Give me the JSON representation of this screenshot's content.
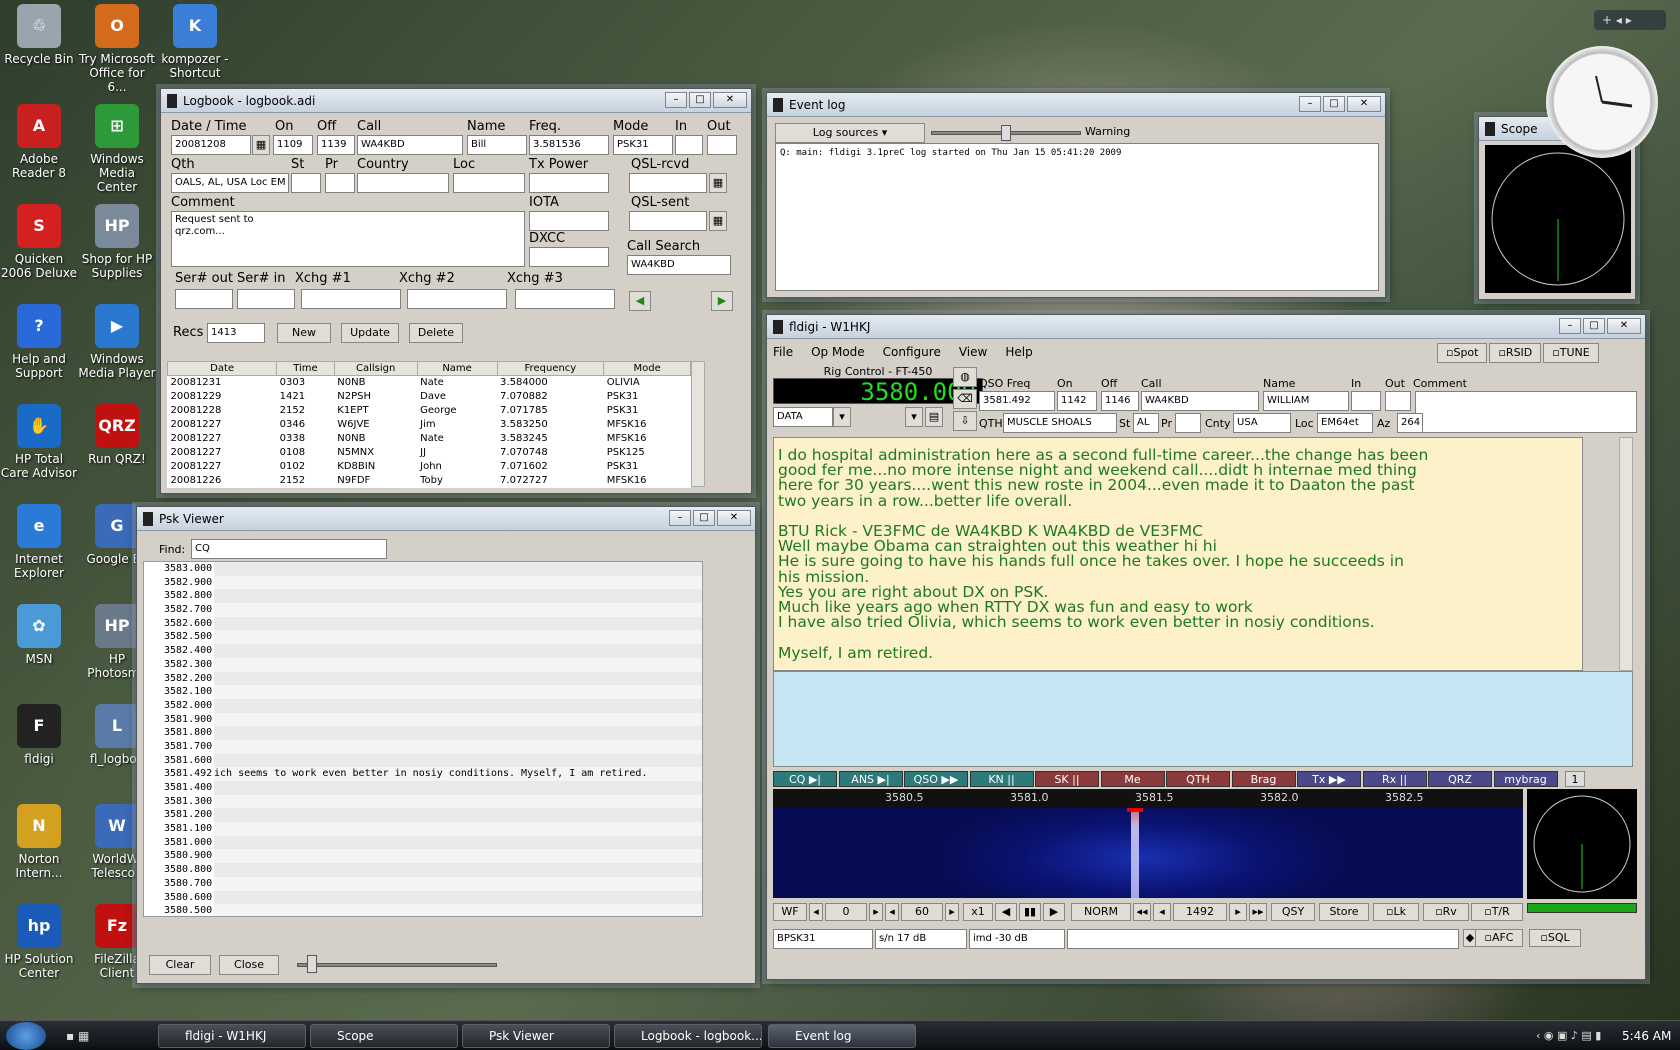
{
  "desktop": {
    "icons": [
      {
        "label": "Recycle Bin",
        "color": "#9aa4ac",
        "glyph": "♲"
      },
      {
        "label": "Try Microsoft Office for 6...",
        "color": "#d46a1c",
        "glyph": "O"
      },
      {
        "label": "kompozer - Shortcut",
        "color": "#3a7ed8",
        "glyph": "K"
      },
      {
        "label": "Adobe Reader 8",
        "color": "#c8201e",
        "glyph": "A"
      },
      {
        "label": "Windows Media Center",
        "color": "#2d9a3a",
        "glyph": "⊞"
      },
      {
        "label": "Quicken 2006 Deluxe",
        "color": "#d42020",
        "glyph": "S"
      },
      {
        "label": "Shop for HP Supplies",
        "color": "#7a8a9a",
        "glyph": "HP"
      },
      {
        "label": "Help and Support",
        "color": "#2a6ad8",
        "glyph": "?"
      },
      {
        "label": "Windows Media Player",
        "color": "#2a78d0",
        "glyph": "▶"
      },
      {
        "label": "HP Total Care Advisor",
        "color": "#1a6ac8",
        "glyph": "✋"
      },
      {
        "label": "Run QRZ!",
        "color": "#c01010",
        "glyph": "QRZ"
      },
      {
        "label": "Internet Explorer",
        "color": "#2a7ad8",
        "glyph": "e"
      },
      {
        "label": "Google Ea",
        "color": "#3a6ab8",
        "glyph": "G"
      },
      {
        "label": "MSN",
        "color": "#4a9ad8",
        "glyph": "✿"
      },
      {
        "label": "HP Photosma",
        "color": "#6a7a8a",
        "glyph": "HP"
      },
      {
        "label": "fldigi",
        "color": "#222",
        "glyph": "F"
      },
      {
        "label": "fl_logboo",
        "color": "#5a7aa8",
        "glyph": "L"
      },
      {
        "label": "Norton Intern...",
        "color": "#d4a020",
        "glyph": "N"
      },
      {
        "label": "WorldWi Telescop",
        "color": "#3a6ab8",
        "glyph": "W"
      },
      {
        "label": "HP Solution Center",
        "color": "#1a5ab8",
        "glyph": "hp"
      },
      {
        "label": "FileZilla Client",
        "color": "#c01010",
        "glyph": "Fz"
      }
    ]
  },
  "logbook": {
    "title": "Logbook - logbook.adi",
    "labels": {
      "datetime": "Date / Time",
      "on": "On",
      "off": "Off",
      "call": "Call",
      "name": "Name",
      "freq": "Freq.",
      "mode": "Mode",
      "in": "In",
      "out": "Out",
      "qth": "Qth",
      "st": "St",
      "pr": "Pr",
      "country": "Country",
      "loc": "Loc",
      "txpower": "Tx Power",
      "qslrcvd": "QSL-rcvd",
      "comment": "Comment",
      "iota": "IOTA",
      "qslsent": "QSL-sent",
      "dxcc": "DXCC",
      "callsearch": "Call Search",
      "serout": "Ser# out",
      "serin": "Ser# in",
      "xchg1": "Xchg #1",
      "xchg2": "Xchg #2",
      "xchg3": "Xchg #3",
      "recs": "Recs"
    },
    "values": {
      "date": "20081208",
      "on": "1109",
      "off": "1139",
      "call": "WA4KBD",
      "name": "Bill",
      "freq": "3.581536",
      "mode": "PSK31",
      "qth": "OALS, AL, USA Loc  EM",
      "comment1": "Request sent to",
      "comment2": "qrz.com...",
      "callsearch": "WA4KBD",
      "recs": "1413"
    },
    "buttons": {
      "new": "New",
      "update": "Update",
      "delete": "Delete"
    },
    "columns": [
      "Date",
      "Time",
      "Callsign",
      "Name",
      "Frequency",
      "Mode"
    ],
    "rows": [
      [
        "20081231",
        "0303",
        "N0NB",
        "Nate",
        "3.584000",
        "OLIVIA"
      ],
      [
        "20081229",
        "1421",
        "N2PSH",
        "Dave",
        "7.070882",
        "PSK31"
      ],
      [
        "20081228",
        "2152",
        "K1EPT",
        "George",
        "7.071785",
        "PSK31"
      ],
      [
        "20081227",
        "0346",
        "W6JVE",
        "Jim",
        "3.583250",
        "MFSK16"
      ],
      [
        "20081227",
        "0338",
        "N0NB",
        "Nate",
        "3.583245",
        "MFSK16"
      ],
      [
        "20081227",
        "0108",
        "N5MNX",
        "JJ",
        "7.070748",
        "PSK125"
      ],
      [
        "20081227",
        "0102",
        "KD8BIN",
        "John",
        "7.071602",
        "PSK31"
      ],
      [
        "20081226",
        "2152",
        "N9FDF",
        "Toby",
        "7.072727",
        "MFSK16"
      ]
    ]
  },
  "eventlog": {
    "title": "Event log",
    "sources_label": "Log sources",
    "level_label": "Warning",
    "text": "Q: main: fldigi 3.1preC log started on Thu Jan 15 05:41:20 2009"
  },
  "scope": {
    "title": "Scope"
  },
  "psk": {
    "title": "Psk Viewer",
    "find_label": "Find:",
    "find_value": "CQ",
    "rows": [
      {
        "f": "3583.000",
        "t": ""
      },
      {
        "f": "3582.900",
        "t": ""
      },
      {
        "f": "3582.800",
        "t": ""
      },
      {
        "f": "3582.700",
        "t": ""
      },
      {
        "f": "3582.600",
        "t": ""
      },
      {
        "f": "3582.500",
        "t": ""
      },
      {
        "f": "3582.400",
        "t": ""
      },
      {
        "f": "3582.300",
        "t": ""
      },
      {
        "f": "3582.200",
        "t": ""
      },
      {
        "f": "3582.100",
        "t": ""
      },
      {
        "f": "3582.000",
        "t": ""
      },
      {
        "f": "3581.900",
        "t": ""
      },
      {
        "f": "3581.800",
        "t": ""
      },
      {
        "f": "3581.700",
        "t": ""
      },
      {
        "f": "3581.600",
        "t": ""
      },
      {
        "f": "3581.492",
        "t": "ich seems to work even better in nosiy conditions.  Myself, I am retired."
      },
      {
        "f": "3581.400",
        "t": ""
      },
      {
        "f": "3581.300",
        "t": ""
      },
      {
        "f": "3581.200",
        "t": ""
      },
      {
        "f": "3581.100",
        "t": ""
      },
      {
        "f": "3581.000",
        "t": ""
      },
      {
        "f": "3580.900",
        "t": ""
      },
      {
        "f": "3580.800",
        "t": ""
      },
      {
        "f": "3580.700",
        "t": ""
      },
      {
        "f": "3580.600",
        "t": ""
      },
      {
        "f": "3580.500",
        "t": ""
      },
      {
        "f": "3580.400",
        "t": ""
      },
      {
        "f": "3580.300",
        "t": ""
      }
    ],
    "clear": "Clear",
    "close": "Close"
  },
  "fldigi": {
    "title": "fldigi - W1HKJ",
    "menu": [
      "File",
      "Op Mode",
      "Configure",
      "View",
      "Help"
    ],
    "toggles": [
      "Spot",
      "RSID",
      "TUNE"
    ],
    "rig_label": "Rig Control - FT-450",
    "rig_freq": "3580.000",
    "rig_mode": "DATA",
    "labels": {
      "qsofreq": "QSO Freq",
      "on": "On",
      "off": "Off",
      "call": "Call",
      "name": "Name",
      "in": "In",
      "out": "Out",
      "comment": "Comment",
      "qth": "QTH",
      "st": "St",
      "pr": "Pr",
      "cnty": "Cnty",
      "loc": "Loc",
      "az": "Az"
    },
    "values": {
      "qsofreq": "3581.492",
      "on": "1142",
      "off": "1146",
      "call": "WA4KBD",
      "name": "WILLIAM",
      "qth": "MUSCLE SHOALS",
      "st": "AL",
      "cnty": "USA",
      "loc": "EM64et",
      "az": "264"
    },
    "rx_lines": [
      "I do hospital administration here as a second full-time career...the change has been",
      "good fer me...no more intense night and weekend call....didt h internae med thing",
      "here for 30 years....went this new roste in 2004...even made it to Daaton the past",
      "two years in a row...better life overall.",
      "",
      "BTU Rick - VE3FMC de WA4KBD K WA4KBD de VE3FMC",
      "Well maybe Obama can straighten out this weather hi hi",
      "He is sure going to have his hands full once he takes over. I hope he succeeds in",
      "his mission.",
      "Yes you are right about DX on PSK.",
      "Much like years ago when RTTY DX was fun and easy to work",
      "I have also tried Olivia, which seems to work even better in nosiy conditions.",
      "",
      "Myself, I am retired."
    ],
    "macros": [
      {
        "label": "CQ ▶|",
        "color": "#2d7a7a"
      },
      {
        "label": "ANS ▶|",
        "color": "#2d7a7a"
      },
      {
        "label": "QSO ▶▶",
        "color": "#2d7a7a"
      },
      {
        "label": "KN ||",
        "color": "#2d7a7a"
      },
      {
        "label": "SK ||",
        "color": "#8a3a3a"
      },
      {
        "label": "Me",
        "color": "#8a3a3a"
      },
      {
        "label": "QTH",
        "color": "#8a3a3a"
      },
      {
        "label": "Brag",
        "color": "#8a3a3a"
      },
      {
        "label": "Tx ▶▶",
        "color": "#4a4a8a"
      },
      {
        "label": "Rx ||",
        "color": "#4a4a8a"
      },
      {
        "label": "QRZ",
        "color": "#4a4a8a"
      },
      {
        "label": "mybrag",
        "color": "#4a4a8a"
      }
    ],
    "macro_page": "1",
    "scale": [
      "3580.5",
      "3581.0",
      "3581.5",
      "3582.0",
      "3582.5"
    ],
    "controls": {
      "wf": "WF",
      "a": "0",
      "b": "60",
      "x": "x1",
      "norm": "NORM",
      "freq": "1492",
      "qsy": "QSY",
      "store": "Store",
      "lk": "Lk",
      "rv": "Rv",
      "tr": "T/R"
    },
    "status": {
      "mode": "BPSK31",
      "sn": "s/n 17 dB",
      "imd": "imd -30 dB",
      "afc": "AFC",
      "sql": "SQL"
    }
  },
  "taskbar": {
    "items": [
      "fldigi - W1HKJ",
      "Scope",
      "Psk Viewer",
      "Logbook - logbook....",
      "Event log"
    ],
    "clock": "5:46 AM"
  },
  "colors": {
    "rx_bg": "#fcf1c8",
    "rx_text": "#1f7a1f",
    "tx_bg": "#c7e6f5",
    "freq_digits": "#22dd22"
  }
}
